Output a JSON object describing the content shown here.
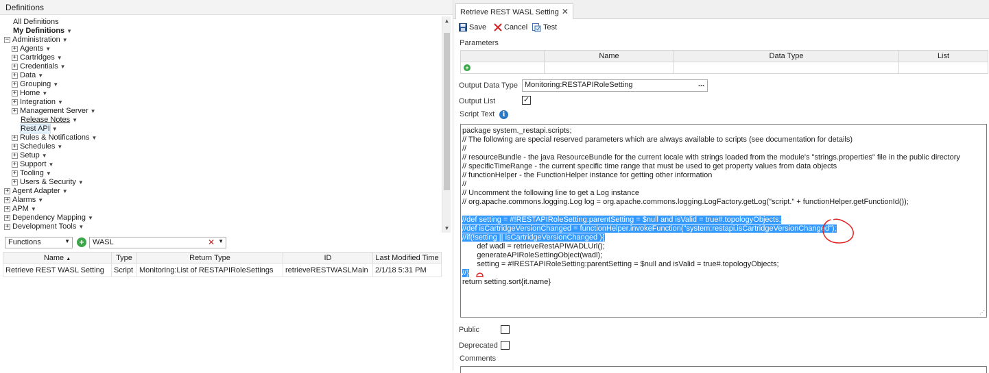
{
  "left": {
    "header": "Definitions",
    "tree": [
      {
        "label": "All Definitions",
        "level": 0,
        "expander": "",
        "dropdown": false,
        "bold": false
      },
      {
        "label": "My Definitions",
        "level": 0,
        "expander": "",
        "dropdown": true,
        "bold": true
      },
      {
        "label": "Administration",
        "level": 0,
        "expander": "−",
        "dropdown": true,
        "bold": false
      },
      {
        "label": "Agents",
        "level": 1,
        "expander": "+",
        "dropdown": true
      },
      {
        "label": "Cartridges",
        "level": 1,
        "expander": "+",
        "dropdown": true
      },
      {
        "label": "Credentials",
        "level": 1,
        "expander": "+",
        "dropdown": true
      },
      {
        "label": "Data",
        "level": 1,
        "expander": "+",
        "dropdown": true
      },
      {
        "label": "Grouping",
        "level": 1,
        "expander": "+",
        "dropdown": true
      },
      {
        "label": "Home",
        "level": 1,
        "expander": "+",
        "dropdown": true
      },
      {
        "label": "Integration",
        "level": 1,
        "expander": "+",
        "dropdown": true
      },
      {
        "label": "Management Server",
        "level": 1,
        "expander": "+",
        "dropdown": true
      },
      {
        "label": "Release Notes",
        "level": 2,
        "expander": "",
        "dropdown": true,
        "underline": true
      },
      {
        "label": "Rest API",
        "level": 2,
        "expander": "",
        "dropdown": true,
        "selected": true
      },
      {
        "label": "Rules & Notifications",
        "level": 1,
        "expander": "+",
        "dropdown": true
      },
      {
        "label": "Schedules",
        "level": 1,
        "expander": "+",
        "dropdown": true
      },
      {
        "label": "Setup",
        "level": 1,
        "expander": "+",
        "dropdown": true
      },
      {
        "label": "Support",
        "level": 1,
        "expander": "+",
        "dropdown": true
      },
      {
        "label": "Tooling",
        "level": 1,
        "expander": "+",
        "dropdown": true
      },
      {
        "label": "Users & Security",
        "level": 1,
        "expander": "+",
        "dropdown": true
      },
      {
        "label": "Agent Adapter",
        "level": 0,
        "expander": "+",
        "dropdown": true
      },
      {
        "label": "Alarms",
        "level": 0,
        "expander": "+",
        "dropdown": true
      },
      {
        "label": "APM",
        "level": 0,
        "expander": "+",
        "dropdown": true
      },
      {
        "label": "Dependency Mapping",
        "level": 0,
        "expander": "+",
        "dropdown": true
      },
      {
        "label": "Development Tools",
        "level": 0,
        "expander": "+",
        "dropdown": true
      }
    ],
    "filter": {
      "type_value": "Functions",
      "search_value": "WASL"
    },
    "table": {
      "columns": [
        "Name",
        "Type",
        "Return Type",
        "ID",
        "Last Modified Time"
      ],
      "sort_indicator": "▲",
      "rows": [
        [
          "Retrieve REST WASL Setting",
          "Script",
          "Monitoring:List of RESTAPIRoleSettings",
          "retrieveRESTWASLMain",
          "2/1/18 5:31 PM"
        ]
      ]
    }
  },
  "right": {
    "tab_title": "Retrieve REST WASL Setting",
    "toolbar": {
      "save": "Save",
      "cancel": "Cancel",
      "test": "Test"
    },
    "parameters_label": "Parameters",
    "params_columns": [
      "Name",
      "Data Type",
      "List"
    ],
    "output_data_type_label": "Output Data Type",
    "output_data_type_value": "Monitoring:RESTAPIRoleSetting",
    "output_list_label": "Output List",
    "output_list_checked": true,
    "script_text_label": "Script Text",
    "script_lines": [
      {
        "text": "package system._restapi.scripts;",
        "hl": ""
      },
      {
        "text": "// The following are special reserved parameters which are always available to scripts (see documentation for details)",
        "hl": ""
      },
      {
        "text": "//",
        "hl": ""
      },
      {
        "text": "// resourceBundle - the java ResourceBundle for the current locale with strings loaded from the module's \"strings.properties\" file in the public directory",
        "hl": ""
      },
      {
        "text": "// specificTimeRange - the current specific time range that must be used to get property values from data objects",
        "hl": ""
      },
      {
        "text": "// functionHelper - the FunctionHelper instance for getting other information",
        "hl": ""
      },
      {
        "text": "//",
        "hl": ""
      },
      {
        "text": "// Uncomment the following line to get a Log instance",
        "hl": ""
      },
      {
        "text": "// org.apache.commons.logging.Log log = org.apache.commons.logging.LogFactory.getLog(\"script.\" + functionHelper.getFunctionId());",
        "hl": ""
      },
      {
        "text": "",
        "hl": ""
      },
      {
        "text": "",
        "hl": "//def setting = #!RESTAPIRoleSetting:parentSetting = $null and isValid = true#.topologyObjects;"
      },
      {
        "text": "",
        "hl": "//def isCartridgeVersionChanged = functionHelper.invokeFunction(\"system:restapi.isCartridgeVersionChanged\");"
      },
      {
        "text": "",
        "hl": "//if(!setting || isCartridgeVersionChanged ){"
      },
      {
        "text": "       def wadl = retrieveRestAPIWADLUrl();",
        "hl": ""
      },
      {
        "text": "       generateAPIRoleSettingObject(wadl);",
        "hl": ""
      },
      {
        "text": "       setting = #!RESTAPIRoleSetting:parentSetting = $null and isValid = true#.topologyObjects;",
        "hl": ""
      },
      {
        "text": "",
        "hl": "//}"
      },
      {
        "text": "return setting.sort{it.name}",
        "hl": ""
      }
    ],
    "public_label": "Public",
    "deprecated_label": "Deprecated",
    "comments_label": "Comments"
  }
}
